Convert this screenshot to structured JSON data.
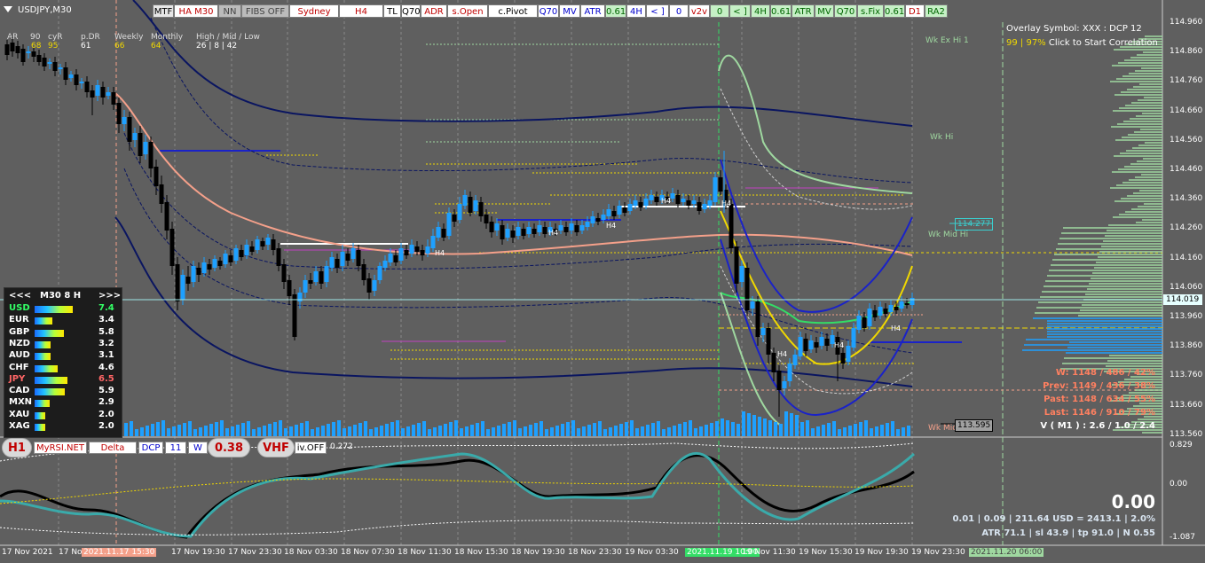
{
  "symbol_title": "USDJPY,M30",
  "toolbar": [
    "MTF",
    "HA M30",
    "NN",
    "FIBS OFF",
    "Sydney",
    "H4",
    "TL",
    "Q70",
    "ADR",
    "s.Open",
    "c.Pivot",
    "Q70",
    "MV",
    "ATR",
    "0.61",
    "4H",
    "< ]",
    "0",
    "v2v",
    "0",
    "< ]",
    "4H",
    "0.61",
    "ATR",
    "MV",
    "Q70",
    "s.Fix",
    "0.61",
    "D1",
    "RA2"
  ],
  "stats_header": {
    "labels": [
      "AR",
      "90",
      "cyR",
      "p.DR",
      "Weekly",
      "Monthly",
      "High / Mid / Low"
    ],
    "values": [
      "68",
      "95",
      "61",
      "66",
      "64",
      "26 | 8 | 42"
    ]
  },
  "overlay": {
    "line1": "Overlay Symbol: XXX : DCP 12",
    "line2_prefix": "99 | 97%",
    "line2_suffix": "Click to Start Correlation"
  },
  "level_labels": {
    "wk_ex_hi": "Wk Ex Hi 1",
    "wk_hi": "Wk Hi",
    "wk_mid_hi": "Wk Mid Hi",
    "wk_mid": "Wk Mid",
    "tag_upper": "114.277",
    "tag_lower": "113.595",
    "h4_markers": [
      "H4",
      "H4",
      "H4",
      "H4",
      "H4",
      "H4",
      "H4",
      "H4"
    ]
  },
  "price_axis": [
    "114.960",
    "114.860",
    "114.760",
    "114.660",
    "114.560",
    "114.460",
    "114.360",
    "114.260",
    "114.160",
    "114.060",
    "113.960",
    "113.860",
    "113.760",
    "113.660",
    "113.560"
  ],
  "current_price": "114.019",
  "indicator_axis": [
    "0.829",
    "0.00",
    "-1.087"
  ],
  "time_axis": [
    "17 Nov 2021",
    "17 No",
    "2021.11.17 15:30",
    "17 Nov 19:30",
    "17 Nov 23:30",
    "18 Nov 03:30",
    "18 Nov 07:30",
    "18 Nov 11:30",
    "18 Nov 15:30",
    "18 Nov 19:30",
    "18 Nov 23:30",
    "19 Nov 03:30",
    "2021.11.19 10:00",
    "19 Nov 11:30",
    "19 Nov 15:30",
    "19 Nov 19:30",
    "19 Nov 23:30",
    "2021.11.20 06:00"
  ],
  "strength_meter": {
    "header_left": "<<<",
    "header_title": "M30  8  H",
    "header_right": ">>>",
    "rows": [
      {
        "cur": "USD",
        "val": "7.4",
        "color": "#33ff66"
      },
      {
        "cur": "EUR",
        "val": "3.4",
        "color": "#ffffff"
      },
      {
        "cur": "GBP",
        "val": "5.8",
        "color": "#ffffff"
      },
      {
        "cur": "NZD",
        "val": "3.2",
        "color": "#ffffff"
      },
      {
        "cur": "AUD",
        "val": "3.1",
        "color": "#ffffff"
      },
      {
        "cur": "CHF",
        "val": "4.6",
        "color": "#ffffff"
      },
      {
        "cur": "JPY",
        "val": "6.5",
        "color": "#ff6666"
      },
      {
        "cur": "CAD",
        "val": "5.9",
        "color": "#ffffff"
      },
      {
        "cur": "MXN",
        "val": "2.9",
        "color": "#ffffff"
      },
      {
        "cur": "XAU",
        "val": "2.0",
        "color": "#ffffff"
      },
      {
        "cur": "XAG",
        "val": "2.0",
        "color": "#ffffff"
      }
    ]
  },
  "range_stats": {
    "w": "W: 1148 / 486 / 42%",
    "prev": "Prev: 1149 / 436 / 38%",
    "past": "Past: 1148 / 634 / 55%",
    "last": "Last: 1146 / 910 / 79%",
    "vm": "V ( M1 ) : 2.6 / 1.0 / 2.4"
  },
  "indicator_panel": {
    "badge_h1": "H1",
    "btn_myrsi": "MyRSI.NET",
    "btn_delta": "Delta",
    "btn_dcp": "DCP",
    "btn_11": "11",
    "btn_w": "W",
    "badge_value": "0.38",
    "badge_vhf": "VHF",
    "btn_iv": "iv.OFF",
    "ind_value": "0.272",
    "big_value": "0.00",
    "info1": "0.01  |  0.09  |  211.64 USD = 2413.1  |  2.0%",
    "info2": "ATR 71.1  |  sl 43.9  |  tp 91.0  |  N 0.55"
  },
  "colors": {
    "background": "#5f5f5f",
    "bull": "#1ea0ff",
    "bear": "#000000",
    "band_dark": "#0a1560",
    "band_blue": "#1a22c8",
    "salmon": "#f4a08a",
    "green_band": "#9fd8a0",
    "yellow": "#f0d800",
    "teal": "#3aaaaa"
  }
}
